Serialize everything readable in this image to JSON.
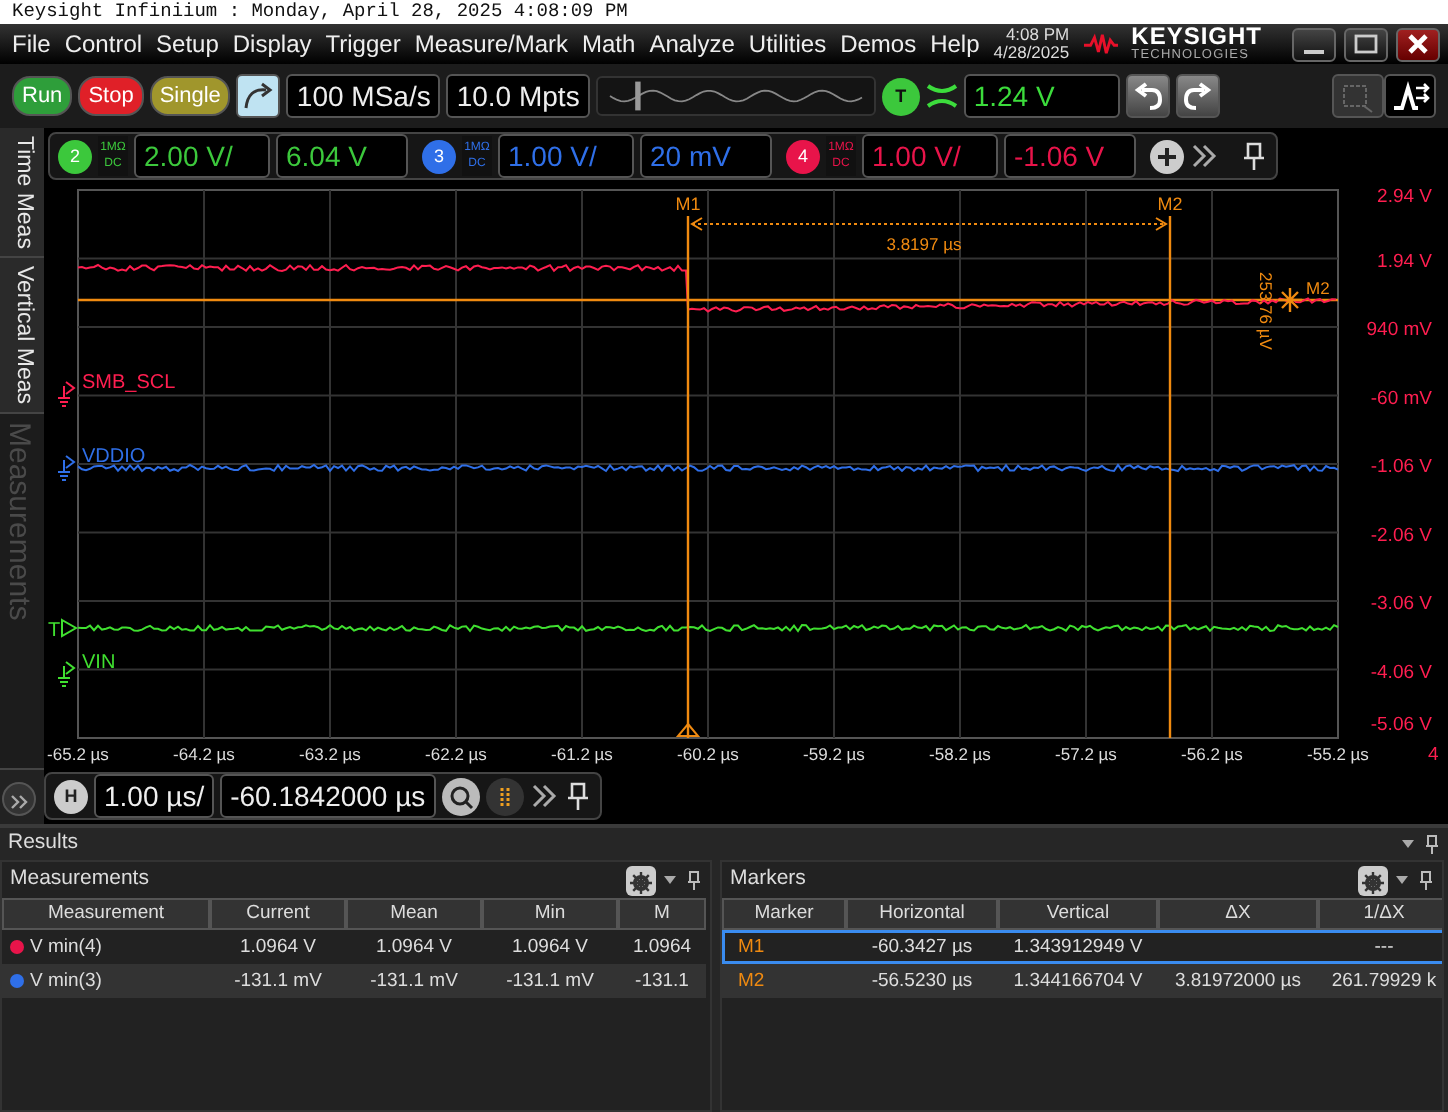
{
  "title_line": "Keysight Infiniium : Monday, April 28, 2025 4:08:09 PM",
  "menu": [
    "File",
    "Control",
    "Setup",
    "Display",
    "Trigger",
    "Measure/Mark",
    "Math",
    "Analyze",
    "Utilities",
    "Demos",
    "Help"
  ],
  "clock": {
    "time": "4:08 PM",
    "date": "4/28/2025"
  },
  "logo": {
    "name": "KEYSIGHT",
    "tagline": "TECHNOLOGIES"
  },
  "toolbar": {
    "acquisition_buttons": [
      {
        "label": "Run",
        "color": "#2e9e3a"
      },
      {
        "label": "Stop",
        "color": "#e02028"
      },
      {
        "label": "Single",
        "color": "#a0962c"
      }
    ],
    "sample_rate": "100 MSa/s",
    "memory_depth": "10.0 Mpts",
    "trigger": {
      "label": "T",
      "trigger_level": "1.24 V"
    }
  },
  "channels": [
    {
      "number": "2",
      "color": "#3cc83c",
      "impedance": "1MΩ",
      "coupling": "DC",
      "scale": "2.00 V/",
      "offset": "6.04 V"
    },
    {
      "number": "3",
      "color": "#2f6fe8",
      "impedance": "1MΩ",
      "coupling": "DC",
      "scale": "1.00 V/",
      "offset": "20 mV"
    },
    {
      "number": "4",
      "color": "#e8144a",
      "impedance": "1MΩ",
      "coupling": "DC",
      "scale": "1.00 V/",
      "offset": "-1.06 V"
    }
  ],
  "side_tabs": [
    {
      "label": "Time Meas",
      "disabled": false
    },
    {
      "label": "Vertical Meas",
      "disabled": false
    },
    {
      "label": "Measurements",
      "disabled": true
    }
  ],
  "display": {
    "y_labels": [
      "2.94 V",
      "1.94 V",
      "940 mV",
      "-60 mV",
      "-1.06 V",
      "-2.06 V",
      "-3.06 V",
      "-4.06 V",
      "-5.06 V"
    ],
    "x_labels": [
      "-65.2 µs",
      "-64.2 µs",
      "-63.2 µs",
      "-62.2 µs",
      "-61.2 µs",
      "-60.2 µs",
      "-59.2 µs",
      "-58.2 µs",
      "-57.2 µs",
      "-56.2 µs",
      "-55.2 µs"
    ],
    "edge_label": "4",
    "waveforms": [
      {
        "label": "SMB_SCL",
        "color": "#ff1e50"
      },
      {
        "label": "VDDIO",
        "color": "#2f6fe8"
      },
      {
        "label": "VIN",
        "color": "#40e030"
      }
    ],
    "trigger_marker": "T",
    "markers": [
      {
        "label": "M1"
      },
      {
        "label": "M2"
      }
    ],
    "delta_x": "3.8197 µs",
    "delta_y": "253.76 µV",
    "marker_tag": "M2"
  },
  "horizontal": {
    "label": "H",
    "scale": "1.00 µs/",
    "position": "-60.1842000 µs"
  },
  "results": {
    "title": "Results",
    "measurements": {
      "title": "Measurements",
      "columns": [
        "Measurement",
        "Current",
        "Mean",
        "Min",
        "M"
      ],
      "rows": [
        {
          "color": "#e8144a",
          "cells": [
            "V min(4)",
            "1.0964 V",
            "1.0964 V",
            "1.0964 V",
            "1.0964"
          ]
        },
        {
          "color": "#2f6fe8",
          "cells": [
            "V min(3)",
            "-131.1 mV",
            "-131.1 mV",
            "-131.1 mV",
            "-131.1"
          ]
        }
      ]
    },
    "markers": {
      "title": "Markers",
      "columns": [
        "Marker",
        "Horizontal",
        "Vertical",
        "ΔX",
        "1/ΔX"
      ],
      "rows": [
        {
          "selected": true,
          "cells": [
            "M1",
            "-60.3427 µs",
            "1.343912949 V",
            null,
            "---"
          ]
        },
        {
          "selected": false,
          "cells": [
            "M2",
            "-56.5230 µs",
            "1.344166704 V",
            "3.81972000 µs",
            "261.79929 k"
          ]
        }
      ]
    }
  }
}
